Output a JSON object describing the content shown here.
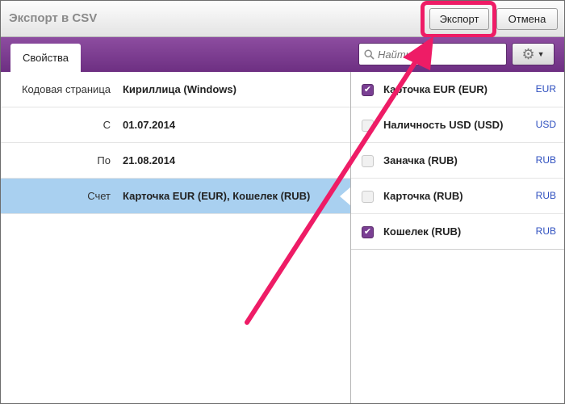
{
  "window": {
    "title": "Экспорт в CSV",
    "export_label": "Экспорт",
    "cancel_label": "Отмена"
  },
  "toolbar": {
    "tab_label": "Свойства",
    "search_placeholder": "Найти",
    "search_icon": "search-icon",
    "settings_icon": "gear-icon"
  },
  "properties": [
    {
      "label": "Кодовая страница",
      "value": "Кириллица (Windows)"
    },
    {
      "label": "С",
      "value": "01.07.2014"
    },
    {
      "label": "По",
      "value": "21.08.2014"
    },
    {
      "label": "Счет",
      "value": "Карточка EUR (EUR), Кошелек (RUB)"
    }
  ],
  "accounts": [
    {
      "name": "Карточка EUR (EUR)",
      "currency": "EUR",
      "checked": true
    },
    {
      "name": "Наличность USD (USD)",
      "currency": "USD",
      "checked": false
    },
    {
      "name": "Заначка (RUB)",
      "currency": "RUB",
      "checked": false
    },
    {
      "name": "Карточка (RUB)",
      "currency": "RUB",
      "checked": false
    },
    {
      "name": "Кошелек (RUB)",
      "currency": "RUB",
      "checked": true
    }
  ],
  "colors": {
    "accent_purple": "#7a3f93",
    "selection_blue": "#a9d0f0",
    "annotation_pink": "#ee1c66",
    "currency_blue": "#2e4fbf"
  }
}
